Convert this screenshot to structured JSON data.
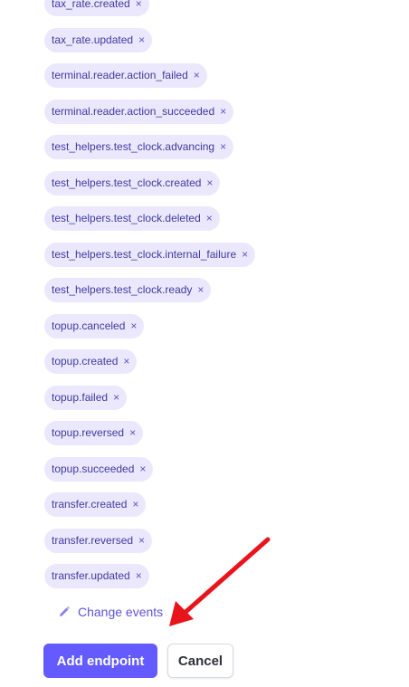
{
  "events": [
    "tax_rate.created",
    "tax_rate.updated",
    "terminal.reader.action_failed",
    "terminal.reader.action_succeeded",
    "test_helpers.test_clock.advancing",
    "test_helpers.test_clock.created",
    "test_helpers.test_clock.deleted",
    "test_helpers.test_clock.internal_failure",
    "test_helpers.test_clock.ready",
    "topup.canceled",
    "topup.created",
    "topup.failed",
    "topup.reversed",
    "topup.succeeded",
    "transfer.created",
    "transfer.reversed",
    "transfer.updated"
  ],
  "remove_glyph": "×",
  "change_events_label": "Change events",
  "add_endpoint_label": "Add endpoint",
  "cancel_label": "Cancel",
  "icons": {
    "chip_remove": "close-icon",
    "change_events": "pencil-icon"
  },
  "colors": {
    "accent": "#635bff",
    "chip_background": "#ebe8fd",
    "chip_text": "#3f3a9e",
    "annotation_arrow": "#e8141b"
  }
}
